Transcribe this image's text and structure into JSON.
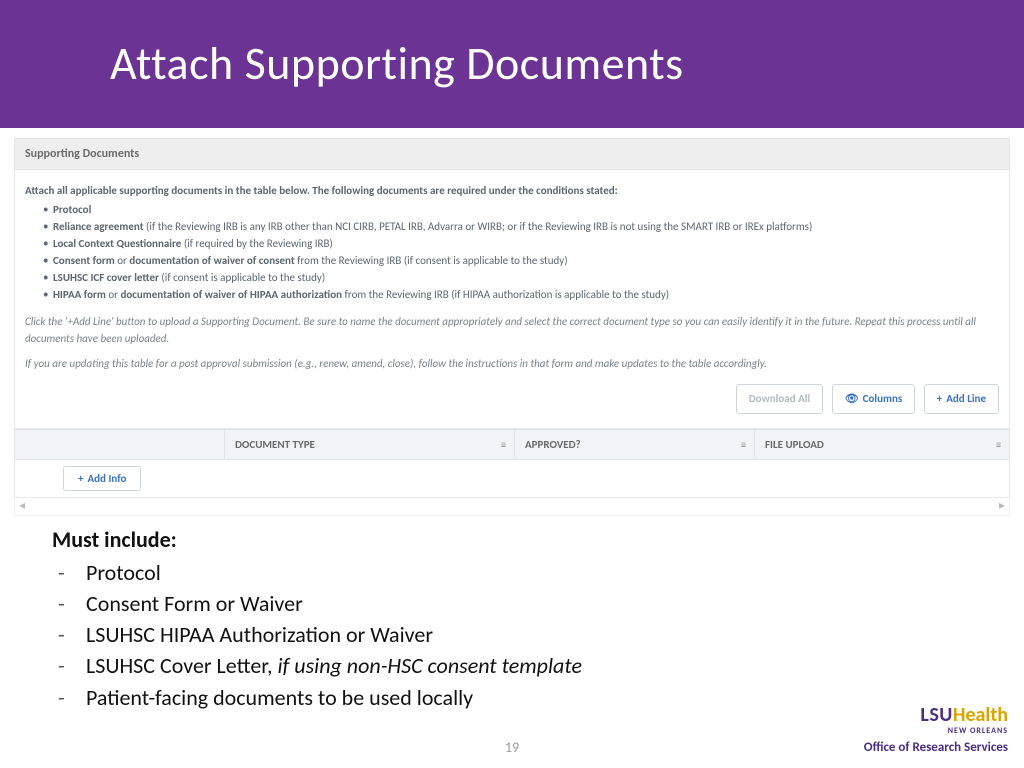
{
  "title": "Attach Supporting Documents",
  "page_number": "19",
  "panel": {
    "title": "Supporting Documents",
    "intro": "Attach all applicable supporting documents in the table below. The following documents are required under the conditions stated:",
    "bullets": {
      "b1": "Protocol",
      "b2_bold": "Reliance agreement",
      "b2_rest": " (if the Reviewing IRB is any IRB other than NCI CIRB, PETAL IRB, Advarra or WIRB; or if the Reviewing IRB is not using the SMART IRB or IREx platforms)",
      "b3_bold": "Local Context Questionnaire",
      "b3_rest": " (if required by the Reviewing IRB)",
      "b4_bold1": "Consent form",
      "b4_mid": " or ",
      "b4_bold2": "documentation of waiver of consent",
      "b4_rest": " from the Reviewing IRB (if consent is applicable to the study)",
      "b5_bold": "LSUHSC ICF cover letter",
      "b5_rest": " (if consent is applicable to the study)",
      "b6_bold1": "HIPAA form",
      "b6_mid": " or ",
      "b6_bold2": "documentation of waiver of HIPAA authorization",
      "b6_rest": " from the Reviewing IRB (if HIPAA authorization is applicable to the study)"
    },
    "hint1": "Click the '+Add Line' button to upload a Supporting Document. Be sure to name the document appropriately and select the correct document type so you can easily identify it in the future. Repeat this process until all documents have been uploaded.",
    "hint2": "If you are updating this table for a post approval submission (e.g., renew, amend, close), follow the instructions in that form and make updates to the table accordingly.",
    "buttons": {
      "download_all": "Download All",
      "columns": "Columns",
      "add_line": "Add Line"
    },
    "headers": {
      "h1": "",
      "h2": "DOCUMENT TYPE",
      "h3": "APPROVED?",
      "h4": "FILE UPLOAD"
    },
    "add_info": "Add Info"
  },
  "notes": {
    "title": "Must include:",
    "items": {
      "i1": "Protocol",
      "i2": "Consent Form or Waiver",
      "i3": "LSUHSC HIPAA Authorization or Waiver",
      "i4a": "LSUHSC Cover Letter, ",
      "i4b": "if using non-HSC consent template",
      "i5": "Patient-facing documents to be used locally"
    }
  },
  "logo": {
    "lsu": "LSU",
    "health": "Health",
    "sub": "NEW ORLEANS",
    "office": "Office of Research Services"
  }
}
